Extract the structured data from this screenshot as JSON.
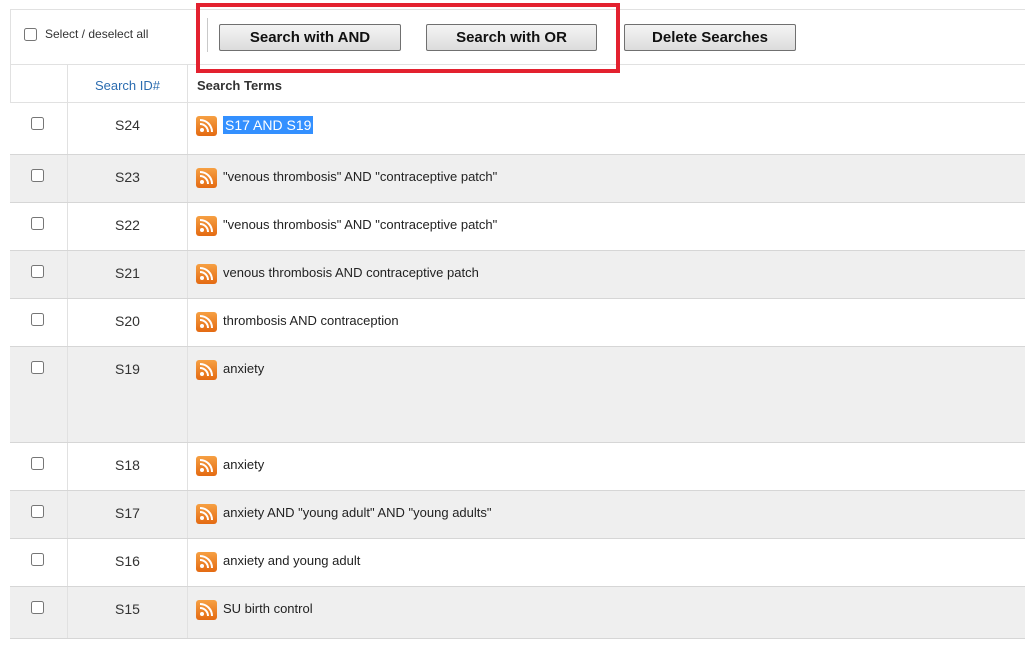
{
  "toolbar": {
    "select_all_label": "Select / deselect all",
    "buttons": {
      "search_and": "Search with AND",
      "search_or": "Search with OR",
      "delete": "Delete Searches"
    }
  },
  "table": {
    "headers": {
      "id": "Search ID#",
      "terms": "Search Terms"
    },
    "rows": [
      {
        "id": "S24",
        "terms": "S17 AND S19",
        "selected_text": true
      },
      {
        "id": "S23",
        "terms": "\"venous thrombosis\" AND \"contraceptive patch\""
      },
      {
        "id": "S22",
        "terms": "\"venous thrombosis\" AND \"contraceptive patch\""
      },
      {
        "id": "S21",
        "terms": "venous thrombosis AND contraceptive patch"
      },
      {
        "id": "S20",
        "terms": "thrombosis AND contraception"
      },
      {
        "id": "S19",
        "terms": "anxiety"
      },
      {
        "id": "S18",
        "terms": "anxiety"
      },
      {
        "id": "S17",
        "terms": "anxiety AND \"young adult\" AND \"young adults\""
      },
      {
        "id": "S16",
        "terms": "anxiety and young adult"
      },
      {
        "id": "S15",
        "terms": "SU birth control"
      }
    ]
  },
  "icons": {
    "row_feed": "rss-feed-icon"
  },
  "colors": {
    "highlight_box": "#e3212f",
    "link_blue": "#2b6cb0",
    "selection": "#3390ff",
    "rss_orange": "#e46a12"
  }
}
